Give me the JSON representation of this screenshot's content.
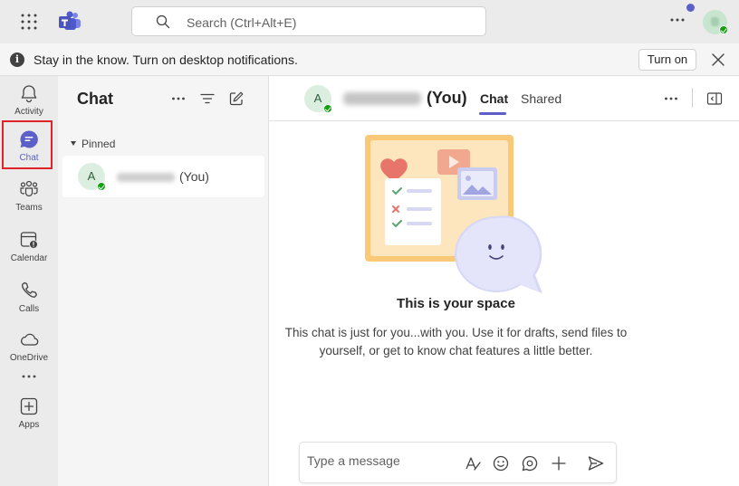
{
  "search": {
    "placeholder": "Search (Ctrl+Alt+E)"
  },
  "banner": {
    "message": "Stay in the know. Turn on desktop notifications.",
    "turn_on_label": "Turn on"
  },
  "rail": {
    "items": [
      {
        "label": "Activity"
      },
      {
        "label": "Chat"
      },
      {
        "label": "Teams"
      },
      {
        "label": "Calendar"
      },
      {
        "label": "Calls"
      },
      {
        "label": "OneDrive"
      },
      {
        "label": "Apps"
      }
    ]
  },
  "chat_list": {
    "title": "Chat",
    "pinned_label": "Pinned",
    "items": [
      {
        "avatar_initial": "A",
        "suffix": "(You)"
      }
    ]
  },
  "conversation": {
    "avatar_initial": "A",
    "name_suffix": "(You)",
    "tabs": [
      {
        "label": "Chat"
      },
      {
        "label": "Shared"
      }
    ],
    "empty_title": "This is your space",
    "empty_description": "This chat is just for you...with you. Use it for drafts, send files to yourself, or get to know chat features a little better."
  },
  "composer": {
    "placeholder": "Type a message"
  },
  "colors": {
    "accent": "#5b5fc7",
    "presence": "#13a10e",
    "highlight": "#e0242a"
  }
}
